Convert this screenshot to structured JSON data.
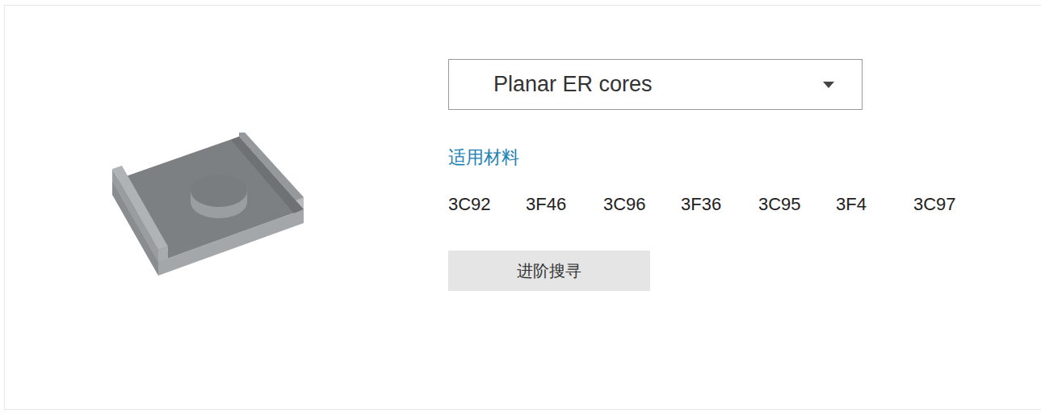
{
  "dropdown": {
    "value": "Planar ER cores"
  },
  "materials": {
    "heading": "适用材料",
    "items": [
      "3C92",
      "3F46",
      "3C96",
      "3F36",
      "3C95",
      "3F4",
      "3C97"
    ]
  },
  "buttons": [
    "进阶搜寻"
  ]
}
